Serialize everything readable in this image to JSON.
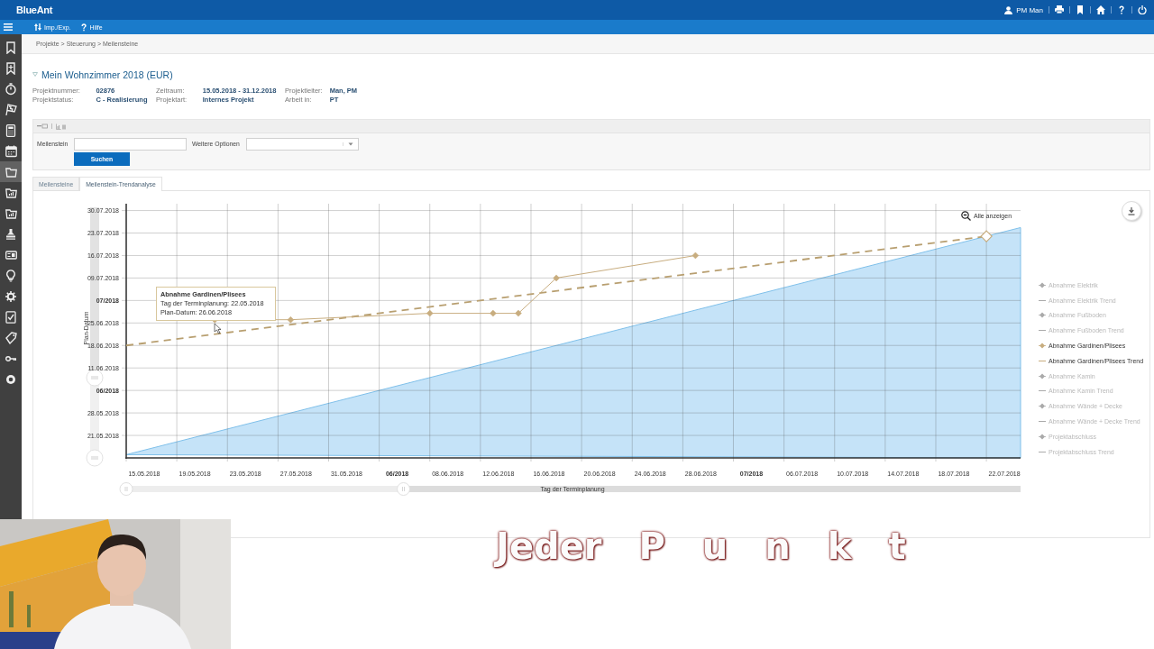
{
  "header": {
    "logo": "BlueAnt",
    "user": "PM Man"
  },
  "toolbar": [
    {
      "kind": "import-export",
      "label": "Imp./Exp."
    },
    {
      "kind": "help",
      "label": "Hilfe"
    }
  ],
  "sidebar": {
    "items": [
      {
        "kind": "bookmark",
        "selected": false
      },
      {
        "kind": "bookmark-plus",
        "selected": false
      },
      {
        "kind": "stopwatch",
        "selected": false
      },
      {
        "kind": "flag",
        "selected": false
      },
      {
        "kind": "calculator",
        "selected": false
      },
      {
        "kind": "calendar",
        "selected": false
      },
      {
        "kind": "folder",
        "selected": true
      },
      {
        "kind": "folder-chart",
        "selected": false
      },
      {
        "kind": "folder-chart",
        "selected": false
      },
      {
        "kind": "stamp",
        "selected": false
      },
      {
        "kind": "card",
        "selected": false
      },
      {
        "kind": "lightbulb",
        "selected": false
      },
      {
        "kind": "gear",
        "selected": false
      },
      {
        "kind": "checklist",
        "selected": false
      },
      {
        "kind": "tag",
        "selected": false
      },
      {
        "kind": "key",
        "selected": false
      },
      {
        "kind": "circle",
        "selected": false
      }
    ]
  },
  "breadcrumb": "Projekte > Steuerung > Meilensteine",
  "project": {
    "title": "Mein Wohnzimmer 2018 (EUR)",
    "expanded": true,
    "columns": [
      [
        {
          "label": "Projektnummer:",
          "value": "02876"
        },
        {
          "label": "Projektstatus:",
          "value": "C - Realisierung"
        }
      ],
      [
        {
          "label": "Zeitraum:",
          "value": "15.05.2018 - 31.12.2018"
        },
        {
          "label": "Projektart:",
          "value": "Internes Projekt"
        }
      ],
      [
        {
          "label": "Projektleiter:",
          "value": "Man, PM"
        },
        {
          "label": "Arbeit in:",
          "value": "PT"
        }
      ]
    ]
  },
  "filter": {
    "milestone_label": "Meilenstein",
    "options_label": "Weitere Optionen",
    "search_button": "Suchen"
  },
  "tabs": [
    {
      "label": "Meilensteine",
      "selected": false
    },
    {
      "label": "Meilenstein-Trendanalyse",
      "selected": true
    }
  ],
  "chart": {
    "reset_zoom": "Alle anzeigen",
    "tooltip": {
      "title": "Abnahme Gardinen/Plisees",
      "lines": [
        "Tag der Terminplanung: 22.05.2018",
        "Plan-Datum: 26.06.2018"
      ]
    },
    "legend": [
      {
        "label": "Abnahme Elektrik",
        "kind": "marker",
        "active": false
      },
      {
        "label": "Abnahme Elektrik Trend",
        "kind": "line",
        "active": false
      },
      {
        "label": "Abnahme Fußboden",
        "kind": "marker",
        "active": false
      },
      {
        "label": "Abnahme Fußboden Trend",
        "kind": "line",
        "active": false
      },
      {
        "label": "Abnahme Gardinen/Plisees",
        "kind": "marker",
        "active": true
      },
      {
        "label": "Abnahme Gardinen/Plisees Trend",
        "kind": "line",
        "active": true
      },
      {
        "label": "Abnahme Kamin",
        "kind": "marker",
        "active": false
      },
      {
        "label": "Abnahme Kamin Trend",
        "kind": "line",
        "active": false
      },
      {
        "label": "Abnahme Wände + Decke",
        "kind": "marker",
        "active": false
      },
      {
        "label": "Abnahme Wände + Decke Trend",
        "kind": "line",
        "active": false
      },
      {
        "label": "Projektabschluss",
        "kind": "marker",
        "active": false
      },
      {
        "label": "Projektabschluss Trend",
        "kind": "line",
        "active": false
      }
    ],
    "x_axis": {
      "title": "Tag der Terminplanung",
      "labels": [
        {
          "label": "15.05.2018",
          "kind": "day"
        },
        {
          "label": "19.05.2018",
          "kind": "day"
        },
        {
          "label": "23.05.2018",
          "kind": "day"
        },
        {
          "label": "27.05.2018",
          "kind": "day"
        },
        {
          "label": "31.05.2018",
          "kind": "day"
        },
        {
          "label": "06/2018",
          "kind": "month"
        },
        {
          "label": "08.06.2018",
          "kind": "day"
        },
        {
          "label": "12.06.2018",
          "kind": "day"
        },
        {
          "label": "16.06.2018",
          "kind": "day"
        },
        {
          "label": "20.06.2018",
          "kind": "day"
        },
        {
          "label": "24.06.2018",
          "kind": "day"
        },
        {
          "label": "28.06.2018",
          "kind": "day"
        },
        {
          "label": "07/2018",
          "kind": "month"
        },
        {
          "label": "06.07.2018",
          "kind": "day"
        },
        {
          "label": "10.07.2018",
          "kind": "day"
        },
        {
          "label": "14.07.2018",
          "kind": "day"
        },
        {
          "label": "18.07.2018",
          "kind": "day"
        },
        {
          "label": "22.07.2018",
          "kind": "day"
        }
      ]
    },
    "y_axis": {
      "title": "Plan-Datum",
      "labels": [
        {
          "label": "30.07.2018",
          "kind": "day"
        },
        {
          "label": "23.07.2018",
          "kind": "day"
        },
        {
          "label": "16.07.2018",
          "kind": "day"
        },
        {
          "label": "09.07.2018",
          "kind": "day"
        },
        {
          "label": "07/2018",
          "kind": "month"
        },
        {
          "label": "25.06.2018",
          "kind": "day"
        },
        {
          "label": "18.06.2018",
          "kind": "day"
        },
        {
          "label": "11.06.2018",
          "kind": "day"
        },
        {
          "label": "06/2018",
          "kind": "month"
        },
        {
          "label": "28.05.2018",
          "kind": "day"
        },
        {
          "label": "21.05.2018",
          "kind": "day"
        }
      ]
    },
    "x_range": {
      "level": 0.31
    },
    "y_range": {
      "level": 0.32
    }
  },
  "caption": [
    "Jeder",
    "P",
    "u",
    "n",
    "k",
    "t"
  ]
}
